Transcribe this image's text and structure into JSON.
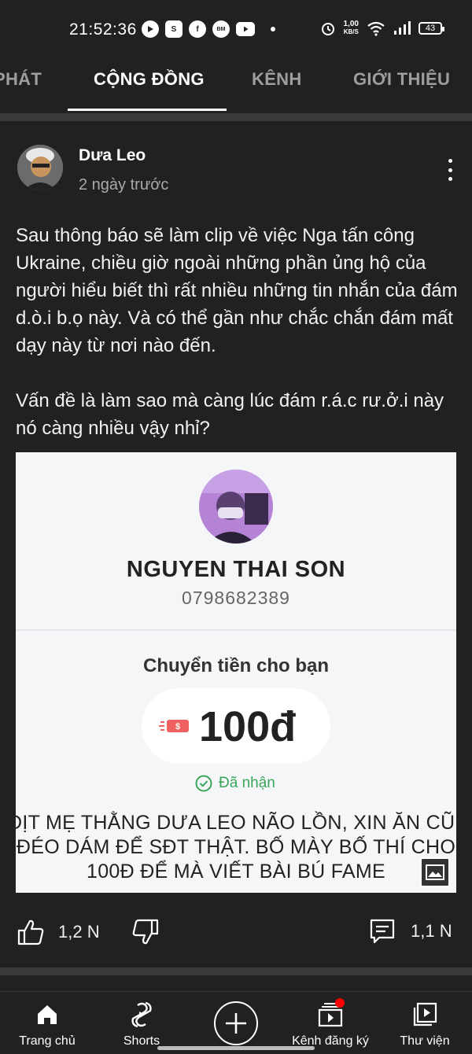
{
  "status_bar": {
    "time": "21:52:36",
    "speed_value": "1,00",
    "speed_unit": "KB/S",
    "battery": "43"
  },
  "tabs": [
    {
      "label": "PHÁT",
      "active": false
    },
    {
      "label": "CỘNG ĐỒNG",
      "active": true
    },
    {
      "label": "KÊNH",
      "active": false
    },
    {
      "label": "GIỚI THIỆU",
      "active": false
    }
  ],
  "post": {
    "author": "Dưa Leo",
    "time": "2 ngày trước",
    "paragraphs": [
      "Sau thông báo sẽ làm clip về việc Nga tấn công Ukraine, chiều giờ ngoài những phần ủng hộ của người hiểu biết thì rất nhiều những tin nhắn của đám d.ò.i b.ọ này. Và có thể gần như chắc chắn đám mất dạy này từ nơi nào đến.",
      "Vấn đề là làm sao mà càng lúc đám r.á.c rư.ở.i này nó càng nhiều vậy nhỉ?"
    ],
    "attachment": {
      "name": "NGUYEN THAI SON",
      "phone": "0798682389",
      "transfer_label": "Chuyển tiền cho bạn",
      "amount": "100đ",
      "status": "Đã nhận",
      "message_lines": [
        "ĐỊT MẸ THẰNG DƯA LEO NÃO LỒN, XIN ĂN CŨNG",
        "ĐÉO DÁM ĐỂ SĐT THẬT. BỐ MÀY BỐ THÍ CHO",
        "100Đ ĐỂ MÀ VIẾT BÀI BÚ FAME"
      ]
    },
    "likes": "1,2 N",
    "comments": "1,1 N"
  },
  "bottom_nav": [
    {
      "label": "Trang chủ",
      "icon": "home-icon"
    },
    {
      "label": "Shorts",
      "icon": "shorts-icon"
    },
    {
      "label": "",
      "icon": "create-icon"
    },
    {
      "label": "Kênh đăng ký",
      "icon": "subscriptions-icon"
    },
    {
      "label": "Thư viện",
      "icon": "library-icon"
    }
  ],
  "colors": {
    "background": "#212121",
    "text": "#f1f1f1",
    "secondary_text": "#aaaaaa",
    "notification_dot": "#ff0000",
    "received_green": "#3aa55a"
  }
}
